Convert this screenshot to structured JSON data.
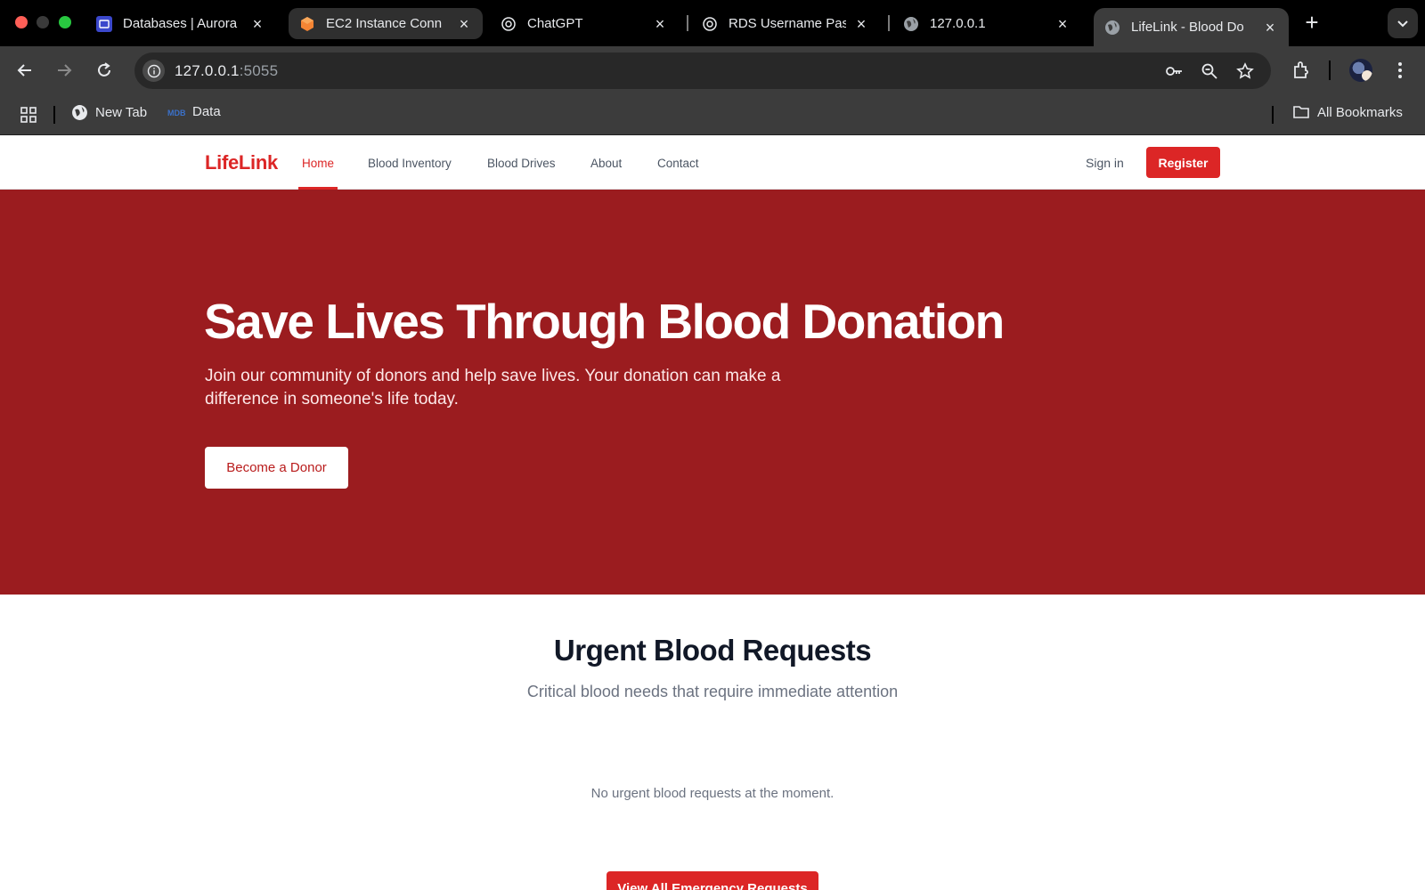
{
  "browser": {
    "tabs": [
      {
        "title": "Databases | Aurora",
        "icon": "aws-rds-icon"
      },
      {
        "title": "EC2 Instance Conn",
        "icon": "aws-ec2-icon"
      },
      {
        "title": "ChatGPT",
        "icon": "chatgpt-icon"
      },
      {
        "title": "RDS Username Pas",
        "icon": "chatgpt-icon"
      },
      {
        "title": "127.0.0.1",
        "icon": "globe-icon"
      },
      {
        "title": "LifeLink - Blood Do",
        "icon": "globe-icon",
        "active": true
      }
    ],
    "url_host": "127.0.0.1",
    "url_port": ":5055",
    "bookmarks": [
      {
        "label": "New Tab",
        "icon": "globe-icon"
      },
      {
        "label": "Data",
        "icon": "mdb-icon"
      }
    ],
    "all_bookmarks_label": "All Bookmarks"
  },
  "site": {
    "logo": "LifeLink",
    "nav": [
      {
        "label": "Home",
        "active": true
      },
      {
        "label": "Blood Inventory"
      },
      {
        "label": "Blood Drives"
      },
      {
        "label": "About"
      },
      {
        "label": "Contact"
      }
    ],
    "signin_label": "Sign in",
    "register_label": "Register"
  },
  "hero": {
    "title": "Save Lives Through Blood Donation",
    "subtitle": "Join our community of donors and help save lives. Your donation can make a difference in someone's life today.",
    "cta_label": "Become a Donor"
  },
  "urgent": {
    "title": "Urgent Blood Requests",
    "subtitle": "Critical blood needs that require immediate attention",
    "empty_message": "No urgent blood requests at the moment.",
    "button_label": "View All Emergency Requests"
  },
  "colors": {
    "brand_red": "#dc2626",
    "hero_bg": "#9b1c1f"
  }
}
